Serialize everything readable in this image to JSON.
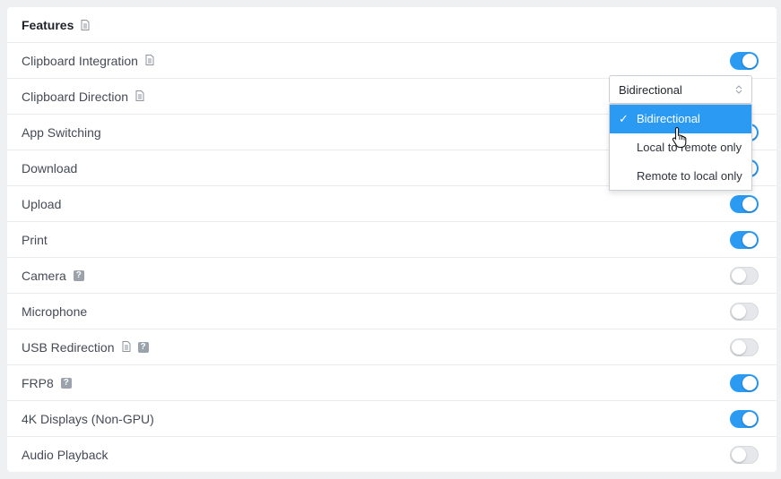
{
  "section": {
    "title": "Features"
  },
  "settings": [
    {
      "label": "Clipboard Integration",
      "doc_icon": true,
      "help_icon": false,
      "control": "toggle",
      "enabled": true
    },
    {
      "label": "Clipboard Direction",
      "doc_icon": true,
      "help_icon": false,
      "control": "select",
      "value": "Bidirectional"
    },
    {
      "label": "App Switching",
      "doc_icon": false,
      "help_icon": false,
      "control": "toggle",
      "enabled": true
    },
    {
      "label": "Download",
      "doc_icon": false,
      "help_icon": false,
      "control": "toggle",
      "enabled": true
    },
    {
      "label": "Upload",
      "doc_icon": false,
      "help_icon": false,
      "control": "toggle",
      "enabled": true
    },
    {
      "label": "Print",
      "doc_icon": false,
      "help_icon": false,
      "control": "toggle",
      "enabled": true
    },
    {
      "label": "Camera",
      "doc_icon": false,
      "help_icon": true,
      "control": "toggle",
      "enabled": false
    },
    {
      "label": "Microphone",
      "doc_icon": false,
      "help_icon": false,
      "control": "toggle",
      "enabled": false
    },
    {
      "label": "USB Redirection",
      "doc_icon": true,
      "help_icon": true,
      "control": "toggle",
      "enabled": false
    },
    {
      "label": "FRP8",
      "doc_icon": false,
      "help_icon": true,
      "control": "toggle",
      "enabled": true
    },
    {
      "label": "4K Displays (Non-GPU)",
      "doc_icon": false,
      "help_icon": false,
      "control": "toggle",
      "enabled": true
    },
    {
      "label": "Audio Playback",
      "doc_icon": false,
      "help_icon": false,
      "control": "toggle",
      "enabled": false
    }
  ],
  "dropdown": {
    "selected": "Bidirectional",
    "options": [
      "Bidirectional",
      "Local to remote only",
      "Remote to local only"
    ]
  },
  "colors": {
    "accent": "#2b9af3",
    "toggle_off": "#e5e7ea",
    "background": "#eef0f2"
  },
  "icons": {
    "doc": "document-icon",
    "help": "help-icon",
    "check": "checkmark-icon",
    "cursor": "hand-pointer-icon"
  }
}
